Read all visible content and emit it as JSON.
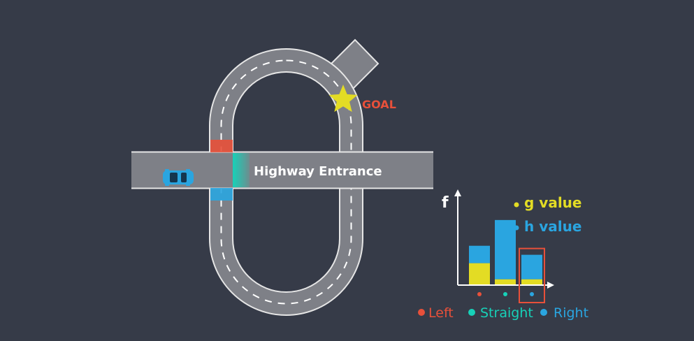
{
  "scene": {
    "background_color": "#363b48",
    "road_color": "#7e8087",
    "road_edge_color": "#e6e6e6",
    "lane_marking_color": "#ffffff",
    "entrance_label": "Highway Entrance",
    "goal_label": "GOAL",
    "goal_color": "#e8503a",
    "star_color": "#e3dc24",
    "car_color": "#2aa5e0",
    "entrance_gate_color": "#17d1b8",
    "left_marker_color": "#e8503a",
    "right_marker_color": "#2aa5e0"
  },
  "chart_data": {
    "type": "bar",
    "ylabel": "f",
    "categories": [
      "Left",
      "Straight",
      "Right"
    ],
    "category_colors": [
      "#e8503a",
      "#17d1b8",
      "#2aa5e0"
    ],
    "series": [
      {
        "name": "g value",
        "color": "#e3dc24",
        "values": [
          0.33,
          0.08,
          0.08
        ]
      },
      {
        "name": "h value",
        "color": "#2aa5e0",
        "values": [
          0.27,
          0.92,
          0.38
        ]
      }
    ],
    "ylim": [
      0,
      1.4
    ],
    "selected_category": "Right",
    "selected_color": "#e8503a",
    "legend": [
      "g value",
      "h value"
    ],
    "legend_placement": "top-right",
    "grid": false
  }
}
